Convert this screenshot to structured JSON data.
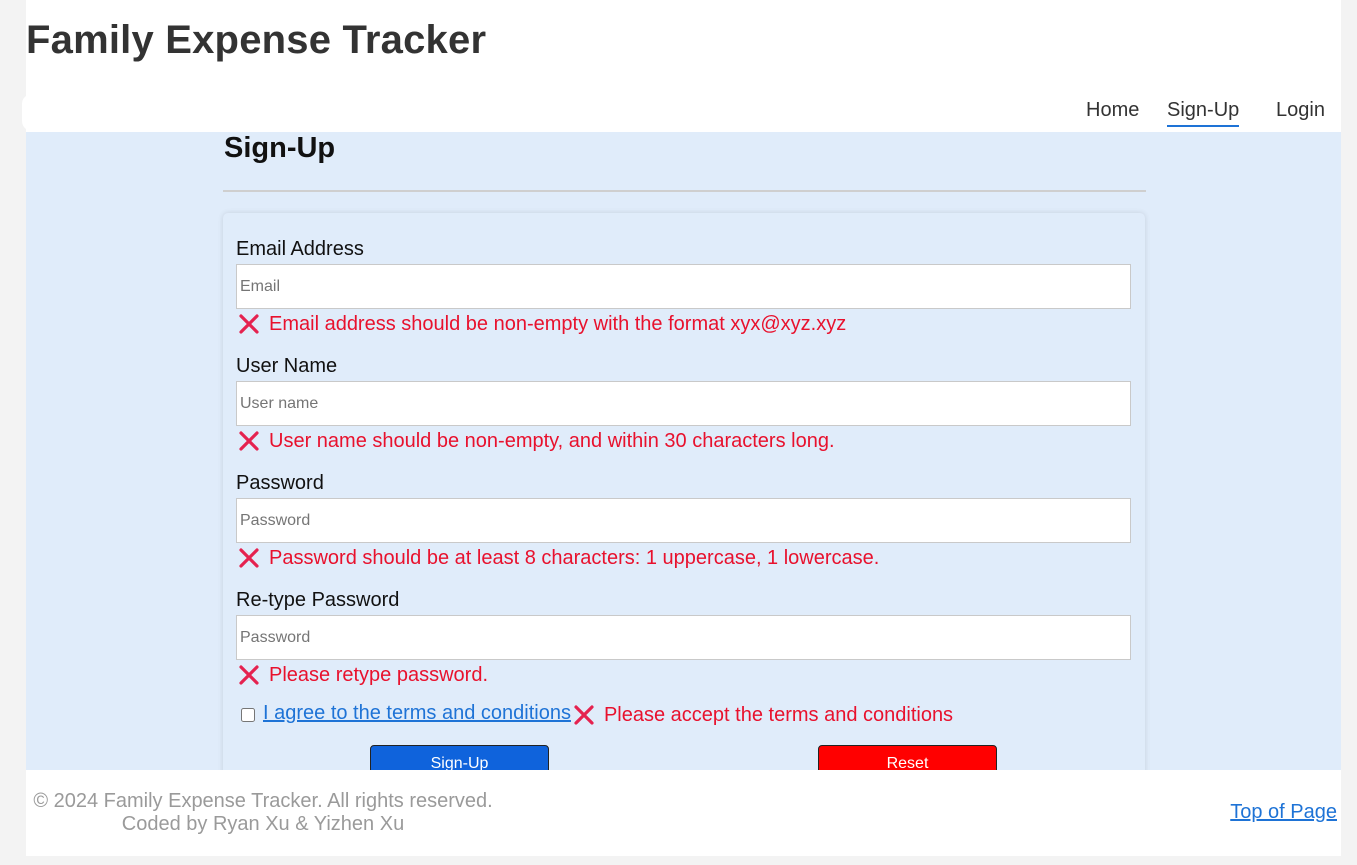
{
  "header": {
    "title": "Family Expense Tracker"
  },
  "nav": {
    "items": [
      {
        "label": "Home"
      },
      {
        "label": "Sign-Up",
        "active": true
      },
      {
        "label": "Login"
      }
    ]
  },
  "signup": {
    "title": "Sign-Up",
    "fields": {
      "email": {
        "label": "Email Address",
        "placeholder": "Email",
        "error": "Email address should be non-empty with the format xyx@xyz.xyz"
      },
      "username": {
        "label": "User Name",
        "placeholder": "User name",
        "error": "User name should be non-empty, and within 30 characters long."
      },
      "password": {
        "label": "Password",
        "placeholder": "Password",
        "error": "Password should be at least 8 characters: 1 uppercase, 1 lowercase."
      },
      "retype": {
        "label": "Re-type Password",
        "placeholder": "Password",
        "error": "Please retype password."
      }
    },
    "terms": {
      "label": "I agree to the terms and conditions",
      "checked": false,
      "error": "Please accept the terms and conditions"
    },
    "buttons": {
      "signup": "Sign-Up",
      "reset": "Reset"
    }
  },
  "footer": {
    "copyright": "© 2024 Family Expense Tracker. All rights reserved.",
    "credits": "Coded by Ryan Xu & Yizhen Xu",
    "top_link": "Top of Page"
  },
  "colors": {
    "accent": "#1e73d6",
    "error": "#e8112d",
    "content_bg": "#e0ecfa",
    "signup_button": "#0f63dc",
    "reset_button": "#ff0000"
  },
  "icons": {
    "error": "close-x-icon"
  }
}
